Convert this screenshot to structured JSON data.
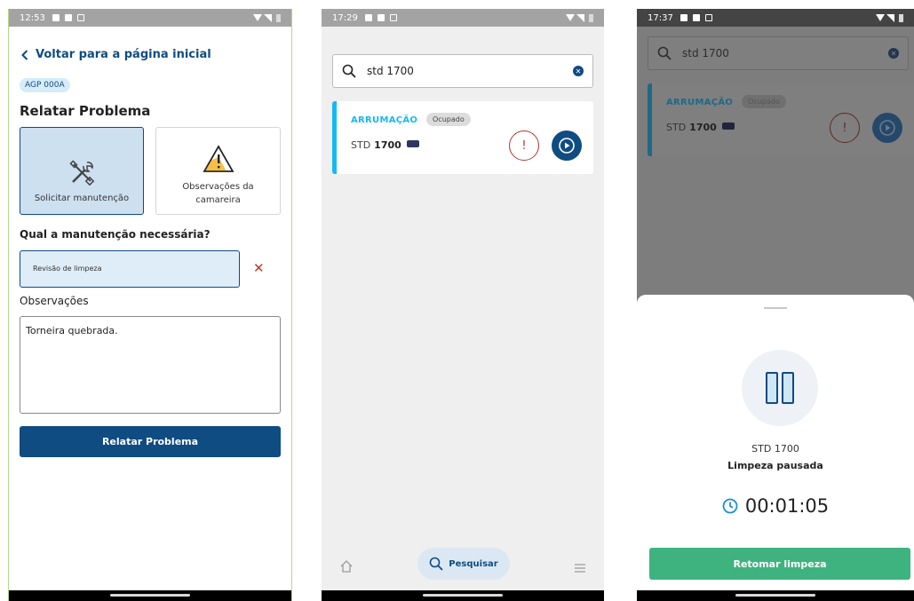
{
  "screen1": {
    "status": {
      "time": "12:53"
    },
    "back_label": "Voltar para a página inicial",
    "room_code": "AGP 000A",
    "title": "Relatar Problema",
    "options": [
      {
        "label": "Solicitar manutenção",
        "icon": "tools-icon",
        "selected": true
      },
      {
        "label": "Observações da camareira",
        "icon": "warning-icon",
        "selected": false
      }
    ],
    "question": "Qual a manutenção necessária?",
    "maintenance_value": "Revisão de limpeza",
    "notes_label": "Observações",
    "notes_value": "Torneira quebrada.",
    "submit_label": "Relatar Problema",
    "colors": {
      "primary": "#0f4c81",
      "selected_bg": "#cde0f0",
      "danger": "#c0392b"
    }
  },
  "screen2": {
    "status": {
      "time": "17:29"
    },
    "search_value": "std 1700",
    "card": {
      "category": "ARRUMAÇÃO",
      "occupancy": "Ocupado",
      "room_type": "STD",
      "room_number": "1700",
      "accent": "#16b8f3"
    },
    "tabs": {
      "search_label": "Pesquisar"
    }
  },
  "screen3": {
    "status": {
      "time": "17:37"
    },
    "search_value": "std 1700",
    "card": {
      "category": "ARRUMAÇÃO",
      "occupancy": "Ocupado",
      "room_type": "STD",
      "room_number": "1700"
    },
    "sheet": {
      "room": "STD 1700",
      "status": "Limpeza pausada",
      "timer": "00:01:05",
      "resume_label": "Retomar limpeza",
      "resume_color": "#3fb37f"
    }
  }
}
